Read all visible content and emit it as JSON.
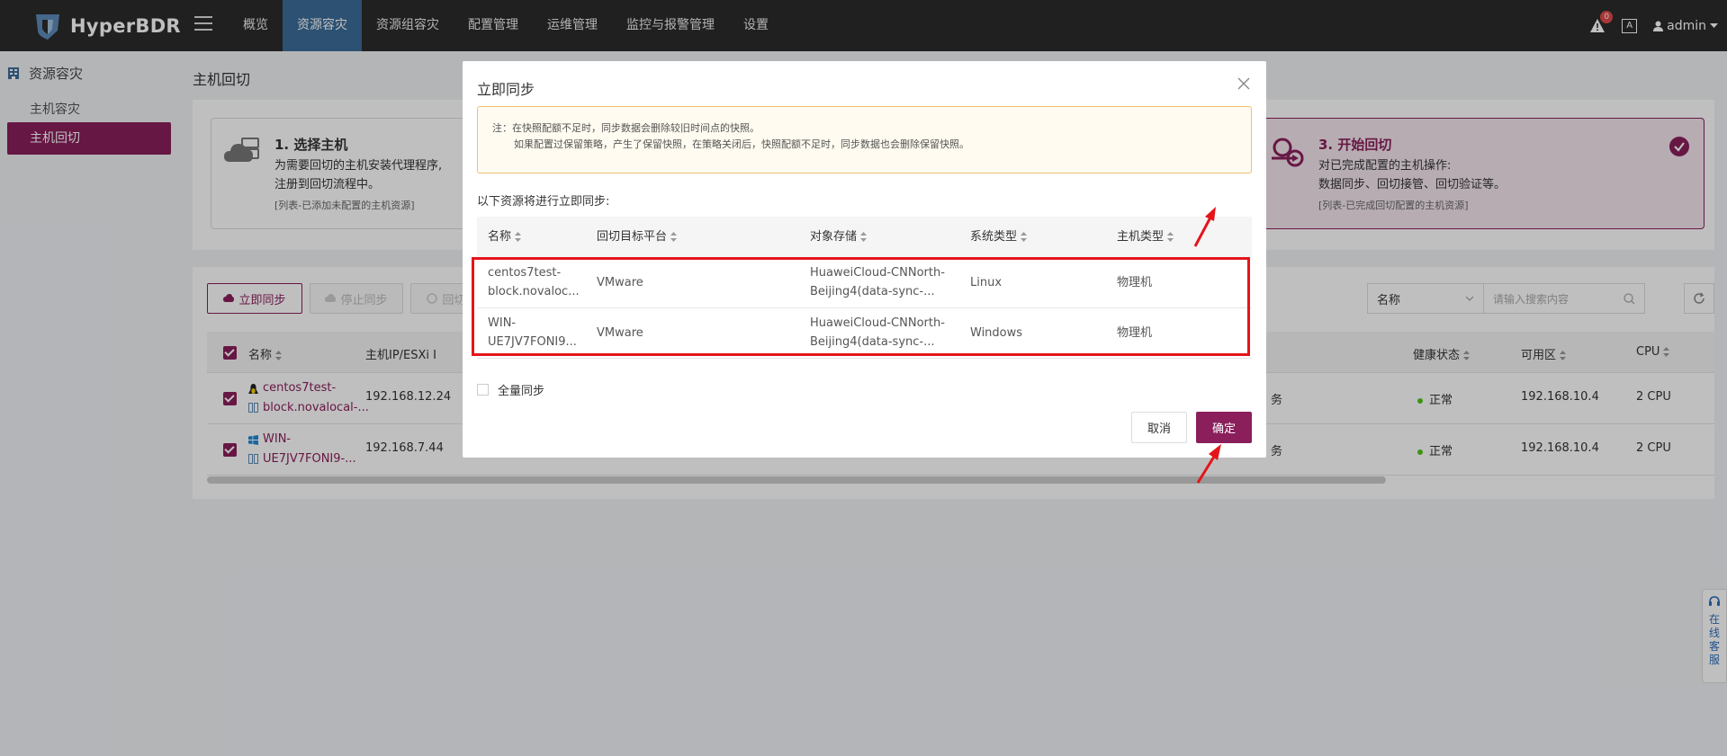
{
  "app": {
    "name": "HyperBDR"
  },
  "nav": [
    {
      "label": "概览"
    },
    {
      "label": "资源容灾",
      "active": true
    },
    {
      "label": "资源组容灾"
    },
    {
      "label": "配置管理"
    },
    {
      "label": "运维管理"
    },
    {
      "label": "监控与报警管理"
    },
    {
      "label": "设置"
    }
  ],
  "topbar": {
    "alert_count": "0",
    "font_icon": "A",
    "user": "admin"
  },
  "sidebar": {
    "section": "资源容灾",
    "items": [
      {
        "label": "主机容灾"
      },
      {
        "label": "主机回切",
        "active": true
      }
    ]
  },
  "page": {
    "title": "主机回切"
  },
  "steps": {
    "step1": {
      "title": "1. 选择主机",
      "desc1": "为需要回切的主机安装代理程序,",
      "desc2": "注册到回切流程中。",
      "note": "[列表-已添加未配置的主机资源]"
    },
    "step3": {
      "title": "3. 开始回切",
      "desc1": "对已完成配置的主机操作:",
      "desc2": "数据同步、回切接管、回切验证等。",
      "note": "[列表-已完成回切配置的主机资源]"
    }
  },
  "toolbar": {
    "sync_now": "立即同步",
    "stop_sync": "停止同步",
    "failback": "回切",
    "search_field": "名称",
    "search_placeholder": "请输入搜索内容"
  },
  "table": {
    "headers": {
      "name": "名称",
      "ip": "主机IP/ESXi I",
      "health": "健康状态",
      "zone": "可用区",
      "cpu": "CPU"
    },
    "rows": [
      {
        "name1": "centos7test-",
        "name2": "block.novalocal-...",
        "ip": "192.168.12.24",
        "extra": "务",
        "health": "正常",
        "zone": "192.168.10.4",
        "cpu": "2 CPU"
      },
      {
        "name1": "WIN-",
        "name2": "UE7JV7FONI9-...",
        "ip": "192.168.7.44",
        "extra": "务",
        "health": "正常",
        "zone": "192.168.10.4",
        "cpu": "2 CPU"
      }
    ]
  },
  "modal": {
    "title": "立即同步",
    "notice_line1": "注：在快照配额不足时，同步数据会删除较旧时间点的快照。",
    "notice_line2": "如果配置过保留策略，产生了保留快照，在策略关闭后，快照配额不足时，同步数据也会删除保留快照。",
    "list_label": "以下资源将进行立即同步:",
    "headers": {
      "name": "名称",
      "platform": "回切目标平台",
      "storage": "对象存储",
      "os": "系统类型",
      "host_type": "主机类型"
    },
    "rows": [
      {
        "name1": "centos7test-",
        "name2": "block.novaloc...",
        "platform": "VMware",
        "storage1": "HuaweiCloud-CNNorth-",
        "storage2": "Beijing4(data-sync-...",
        "os": "Linux",
        "host_type": "物理机"
      },
      {
        "name1": "WIN-",
        "name2": "UE7JV7FONI9...",
        "platform": "VMware",
        "storage1": "HuaweiCloud-CNNorth-",
        "storage2": "Beijing4(data-sync-...",
        "os": "Windows",
        "host_type": "物理机"
      }
    ],
    "full_sync": "全量同步",
    "cancel": "取消",
    "confirm": "确定"
  },
  "service": {
    "label": "在线客服"
  },
  "colors": {
    "brand": "#8a1f5b",
    "nav_active": "#3d6d9a",
    "highlight": "#e4151a"
  }
}
